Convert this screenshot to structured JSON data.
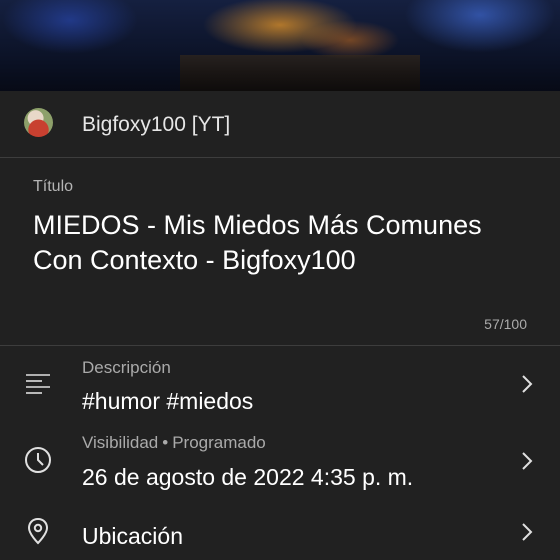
{
  "channel": {
    "name": "Bigfoxy100 [YT]"
  },
  "title_section": {
    "label": "Título",
    "value": "MIEDOS - Mis Miedos Más Comunes Con Contexto - Bigfoxy100",
    "counter": "57/100"
  },
  "description": {
    "label": "Descripción",
    "value": "#humor #miedos",
    "icon": "description-lines-icon"
  },
  "visibility": {
    "label": "Visibilidad",
    "separator": "•",
    "status": "Programado",
    "value": "26 de agosto de 2022 4:35 p. m.",
    "icon": "clock-icon"
  },
  "location": {
    "value": "Ubicación",
    "icon": "location-pin-icon"
  },
  "colors": {
    "background": "#212121",
    "text": "#ffffff",
    "muted": "#aaaaaa",
    "divider": "#3d3d3d"
  }
}
